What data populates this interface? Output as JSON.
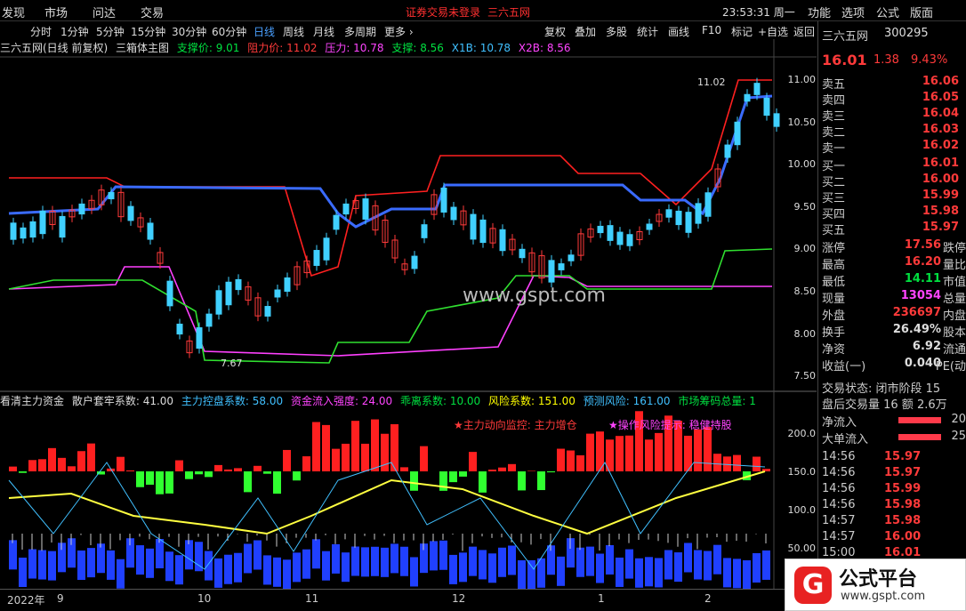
{
  "menu": {
    "items": [
      "发现",
      "市场",
      "问达",
      "交易"
    ],
    "notice1": "证券交易未登录",
    "notice2": "三六五网",
    "clock": "23:53:31 周一",
    "right": [
      "功能",
      "选项",
      "公式",
      "版面"
    ]
  },
  "timeframes": [
    "分时",
    "1分钟",
    "5分钟",
    "15分钟",
    "30分钟",
    "60分钟",
    "日线",
    "周线",
    "月线",
    "多周期",
    "更多 ›"
  ],
  "active_tf": "日线",
  "toolbar": [
    "复权",
    "叠加",
    "多股",
    "统计",
    "画线",
    "F10",
    "标记",
    "+自选",
    "返回"
  ],
  "main_info": {
    "name": "三六五网(日线 前复权)",
    "indicator": "三箱体主图",
    "support": "支撑价: 9.01",
    "resist": "阻力价: 11.02",
    "pressure": "压力: 10.78",
    "support2": "支撑: 8.56",
    "x1b": "X1B: 10.78",
    "x2b": "X2B: 8.56"
  },
  "axis_main": [
    "11.00",
    "10.50",
    "10.00",
    "9.50",
    "9.00",
    "8.50",
    "8.00",
    "7.50"
  ],
  "annotations": {
    "high": "11.02",
    "low": "7.67"
  },
  "sub_info": {
    "name": "看清主力资金",
    "p1": "散户套牢系数: 41.00",
    "p2": "主力控盘系数: 58.00",
    "p3": "资金流入强度: 24.00",
    "p4": "乖离系数: 10.00",
    "p5": "风险系数: 151.00",
    "p6": "预测风险: 161.00",
    "p7": "市场筹码总量: 1"
  },
  "alerts": {
    "a1": "★主力动向监控: 主力增仓",
    "a2": "★操作风险提示: 稳健持股"
  },
  "axis_sub": [
    "200.0",
    "150.0",
    "100.0",
    "50.00"
  ],
  "dates": [
    "2022年",
    "9",
    "10",
    "11",
    "12",
    "1",
    "2"
  ],
  "watermark": "www.gspt.com",
  "quote": {
    "name": "三六五网",
    "code": "300295",
    "price": "16.01",
    "change": "1.38",
    "pct": "9.43%",
    "asks": [
      [
        "卖五",
        "16.06"
      ],
      [
        "卖四",
        "16.05"
      ],
      [
        "卖三",
        "16.04"
      ],
      [
        "卖二",
        "16.03"
      ],
      [
        "卖一",
        "16.02"
      ]
    ],
    "bids": [
      [
        "买一",
        "16.01"
      ],
      [
        "买二",
        "16.00"
      ],
      [
        "买三",
        "15.99"
      ],
      [
        "买四",
        "15.98"
      ],
      [
        "买五",
        "15.97"
      ]
    ],
    "stats": [
      [
        "涨停",
        "17.56",
        "跌停"
      ],
      [
        "最高",
        "16.20",
        "量比"
      ],
      [
        "最低",
        "14.11",
        "市值"
      ],
      [
        "现量",
        "13054",
        "总量"
      ],
      [
        "外盘",
        "236697",
        "内盘"
      ],
      [
        "换手",
        "26.49%",
        "股本"
      ],
      [
        "净资",
        "6.92",
        "流通"
      ],
      [
        "收益(一)",
        "0.040",
        "PE(动"
      ]
    ],
    "status": "交易状态: 闭市阶段 15",
    "after": "盘后交易量 16 额 2.6万",
    "flows": [
      [
        "净流入",
        "20"
      ],
      [
        "大单流入",
        "25"
      ]
    ],
    "ticks": [
      [
        "14:56",
        "15.97"
      ],
      [
        "14:56",
        "15.97"
      ],
      [
        "14:56",
        "15.99"
      ],
      [
        "14:56",
        "15.98"
      ],
      [
        "14:57",
        "15.98"
      ],
      [
        "14:57",
        "16.00"
      ],
      [
        "15:00",
        "16.01"
      ]
    ]
  },
  "logo": {
    "icon": "G",
    "title": "公式平台",
    "url": "www.gspt.com"
  }
}
